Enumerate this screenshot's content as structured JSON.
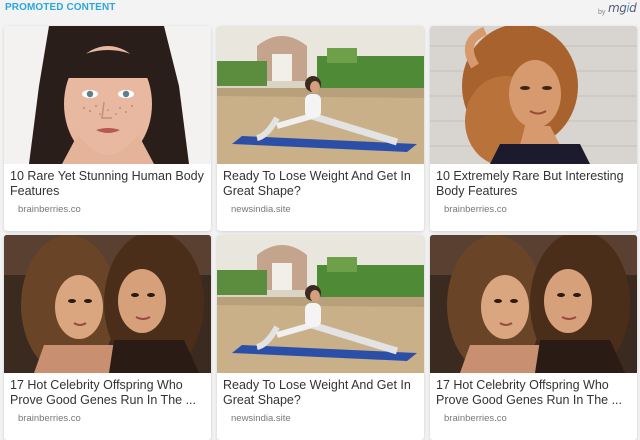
{
  "header": {
    "label": "PROMOTED CONTENT",
    "by": "by",
    "brand": "mgid"
  },
  "cards": [
    {
      "title": "10 Rare Yet Stunning Human Body Features",
      "source": "brainberries.co",
      "image": "woman-freckles-bangs"
    },
    {
      "title": "Ready To Lose Weight And Get In Great Shape?",
      "source": "newsindia.site",
      "image": "woman-yoga-split"
    },
    {
      "title": "10 Extremely Rare But Interesting Body Features",
      "source": "brainberries.co",
      "image": "woman-curly-hair"
    },
    {
      "title": "17 Hot Celebrity Offspring Who Prove Good Genes Run In The ...",
      "source": "brainberries.co",
      "image": "mother-daughter-selfie"
    },
    {
      "title": "Ready To Lose Weight And Get In Great Shape?",
      "source": "newsindia.site",
      "image": "woman-yoga-split"
    },
    {
      "title": "17 Hot Celebrity Offspring Who Prove Good Genes Run In The ...",
      "source": "brainberries.co",
      "image": "mother-daughter-selfie"
    }
  ],
  "colors": {
    "accent": "#29a8e0",
    "background": "#f3f3f3",
    "title_text": "#333333",
    "source_text": "#777777"
  }
}
